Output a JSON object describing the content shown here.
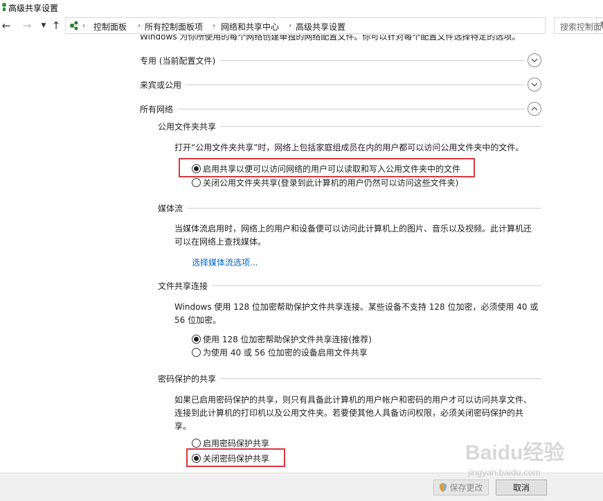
{
  "window": {
    "title": "高级共享设置"
  },
  "nav": {
    "breadcrumbs": [
      "控制面板",
      "所有控制面板项",
      "网络和共享中心",
      "高级共享设置"
    ],
    "search_placeholder": "搜索控制面板"
  },
  "intro_cut": "Windows 为你所使用的每个网络创建单独的网络配置文件。你可以针对每个配置文件选择特定的选项。",
  "profiles": [
    {
      "label": "专用 (当前配置文件)",
      "expanded": false
    },
    {
      "label": "来宾或公用",
      "expanded": false
    },
    {
      "label": "所有网络",
      "expanded": true
    }
  ],
  "public_folder": {
    "heading": "公用文件夹共享",
    "description": "打开“公用文件夹共享”时，网络上包括家庭组成员在内的用户都可以访问公用文件夹中的文件。",
    "options": [
      {
        "label": "启用共享以便可以访问网络的用户可以读取和写入公用文件夹中的文件",
        "checked": true
      },
      {
        "label": "关闭公用文件夹共享(登录到此计算机的用户仍然可以访问这些文件夹)",
        "checked": false
      }
    ]
  },
  "media": {
    "heading": "媒体流",
    "description_line1": "当媒体流启用时，网络上的用户和设备便可以访问此计算机上的图片、音乐以及视频。此计算机还",
    "description_line2": "可以在网络上查找媒体。",
    "link": "选择媒体流选项..."
  },
  "file_sharing": {
    "heading": "文件共享连接",
    "description_line1": "Windows 使用 128 位加密帮助保护文件共享连接。某些设备不支持 128 位加密，必须使用 40 或",
    "description_line2": "56 位加密。",
    "options": [
      {
        "label": "使用 128 位加密帮助保护文件共享连接(推荐)",
        "checked": true
      },
      {
        "label": "为使用 40 或 56 位加密的设备启用文件共享",
        "checked": false
      }
    ]
  },
  "password": {
    "heading": "密码保护的共享",
    "description_line1": "如果已启用密码保护的共享，则只有具备此计算机的用户帐户和密码的用户才可以访问共享文件、",
    "description_line2": "连接到此计算机的打印机以及公用文件夹。若要使其他人具备访问权限，必须关闭密码保护的共",
    "description_line3": "享。",
    "options": [
      {
        "label": "启用密码保护共享",
        "checked": false
      },
      {
        "label": "关闭密码保护共享",
        "checked": true
      }
    ]
  },
  "footer": {
    "save_label": "保存更改",
    "cancel_label": "取消"
  },
  "watermark": {
    "text": "Baidu经验",
    "sub": "jingyan.baidu.com"
  },
  "colors": {
    "highlight": "#d9363e",
    "link": "#0066cc"
  }
}
